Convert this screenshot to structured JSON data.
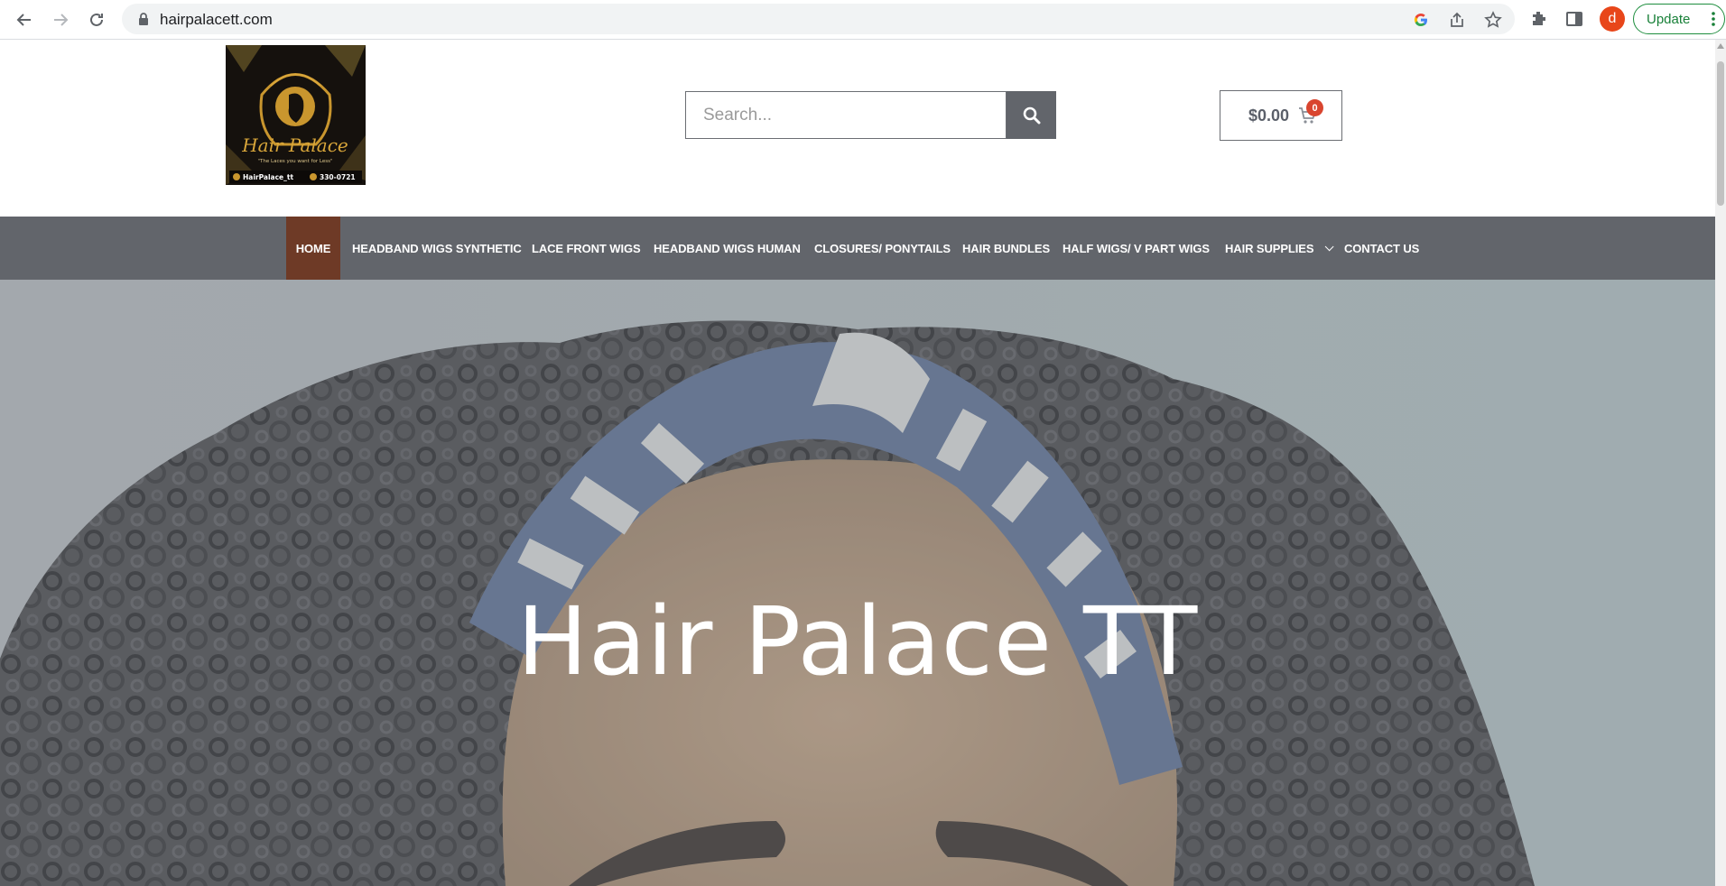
{
  "browser": {
    "url": "hairpalacett.com",
    "avatar_letter": "d",
    "update_label": "Update"
  },
  "header": {
    "logo": {
      "brand_text": "Hair Palace",
      "tagline": "\"The Laces you want for Less\"",
      "handle": "HairPalace_tt",
      "phone": "330-0721"
    },
    "search": {
      "placeholder": "Search..."
    },
    "cart": {
      "amount": "$0.00",
      "count": "0"
    }
  },
  "nav": {
    "items": [
      {
        "label": "HOME",
        "active": true
      },
      {
        "label": "HEADBAND WIGS SYNTHETIC"
      },
      {
        "label": "LACE FRONT WIGS"
      },
      {
        "label": "HEADBAND WIGS HUMAN"
      },
      {
        "label": "CLOSURES/ PONYTAILS"
      },
      {
        "label": "HAIR BUNDLES"
      },
      {
        "label": "HALF WIGS/ V PART WIGS"
      },
      {
        "label": "HAIR SUPPLIES",
        "has_dropdown": true
      },
      {
        "label": "CONTACT US"
      }
    ]
  },
  "hero": {
    "title": "Hair Palace TT"
  },
  "colors": {
    "nav_bg": "#62656b",
    "nav_active": "#6e3a26",
    "cart_badge": "#d9452f",
    "update_green": "#188038"
  }
}
